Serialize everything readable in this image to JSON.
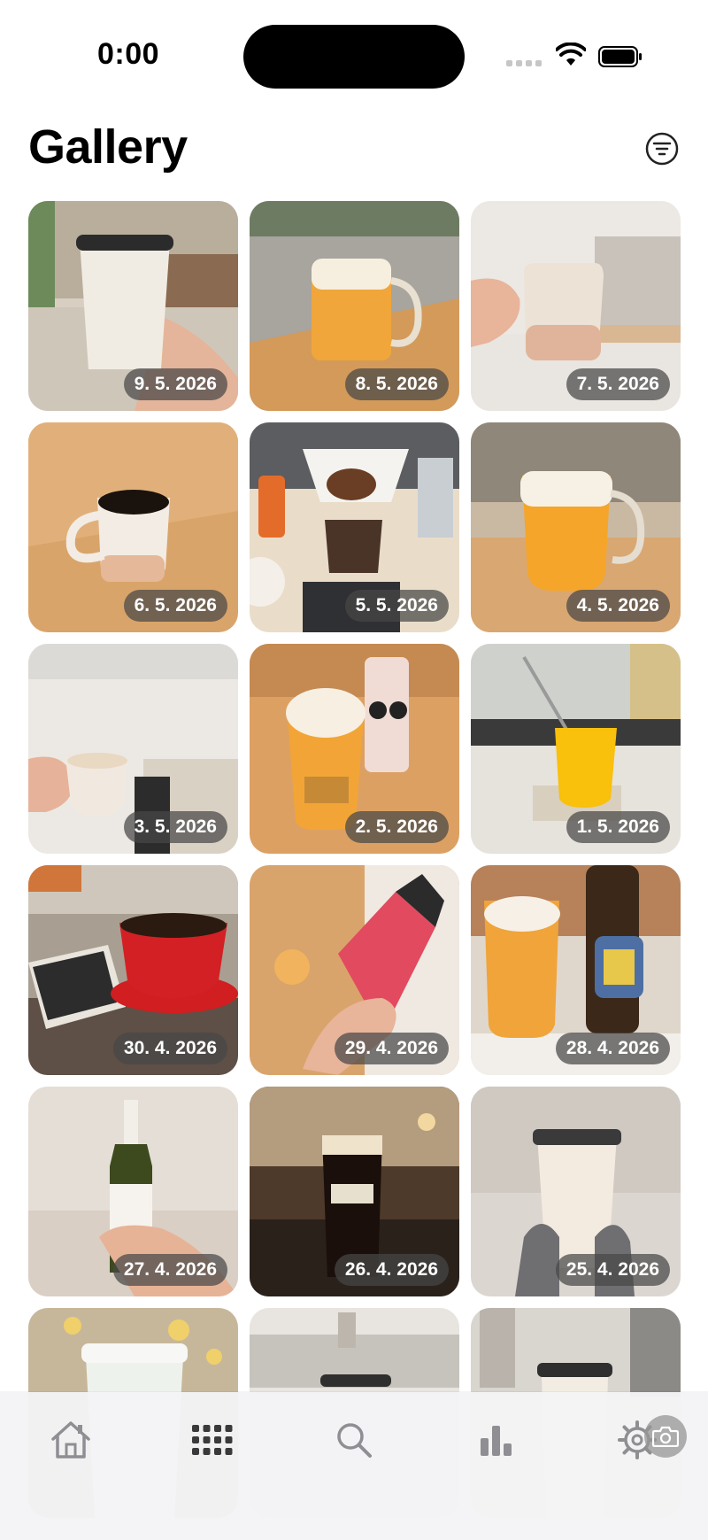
{
  "status_bar": {
    "time": "0:00"
  },
  "header": {
    "title": "Gallery",
    "filter_icon": "filter-lines-icon"
  },
  "gallery": {
    "items": [
      {
        "date": "9. 5. 2026",
        "subject": "takeaway-coffee-cup"
      },
      {
        "date": "8. 5. 2026",
        "subject": "beer-mug"
      },
      {
        "date": "7. 5. 2026",
        "subject": "ceramic-mug"
      },
      {
        "date": "6. 5. 2026",
        "subject": "black-coffee-mug"
      },
      {
        "date": "5. 5. 2026",
        "subject": "pour-over-coffee"
      },
      {
        "date": "4. 5. 2026",
        "subject": "beer-mug"
      },
      {
        "date": "3. 5. 2026",
        "subject": "espresso-cup"
      },
      {
        "date": "2. 5. 2026",
        "subject": "beer-glass-and-can"
      },
      {
        "date": "1. 5. 2026",
        "subject": "orange-drink"
      },
      {
        "date": "30. 4. 2026",
        "subject": "red-coffee-cup"
      },
      {
        "date": "29. 4. 2026",
        "subject": "pink-can"
      },
      {
        "date": "28. 4. 2026",
        "subject": "beer-and-bottle"
      },
      {
        "date": "27. 4. 2026",
        "subject": "wine-bottle"
      },
      {
        "date": "26. 4. 2026",
        "subject": "guinness-pint"
      },
      {
        "date": "25. 4. 2026",
        "subject": "takeaway-coffee-cup"
      },
      {
        "date": "",
        "subject": "takeaway-coffee-cup"
      },
      {
        "date": "",
        "subject": "takeaway-coffee-cup"
      },
      {
        "date": "",
        "subject": "takeaway-coffee-cup"
      }
    ]
  },
  "tab_bar": {
    "tabs": [
      {
        "icon": "home-icon",
        "selected": false
      },
      {
        "icon": "grid-icon",
        "selected": true
      },
      {
        "icon": "search-icon",
        "selected": false
      },
      {
        "icon": "stats-icon",
        "selected": false
      },
      {
        "icon": "settings-icon",
        "selected": false
      }
    ],
    "camera_icon": "camera-icon"
  },
  "colors": {
    "icon_gray": "#8e8e93",
    "selected_tab": "#3a3a3c",
    "date_badge": "#464646"
  }
}
